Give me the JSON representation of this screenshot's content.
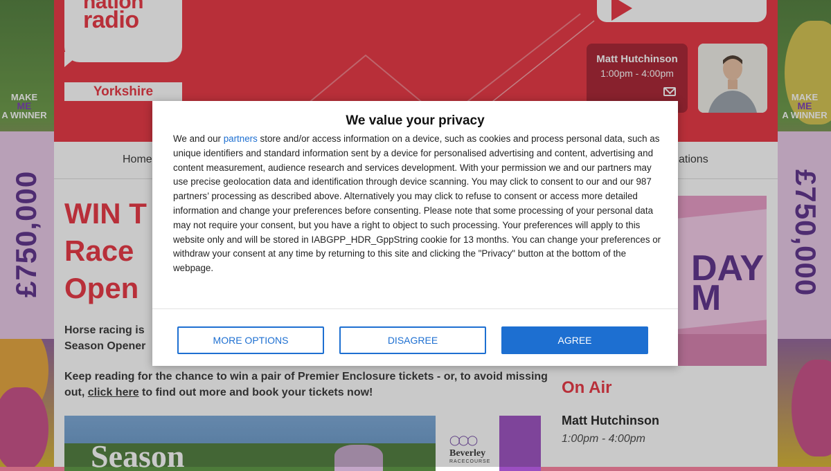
{
  "site": {
    "logo_top": "nation",
    "logo_bottom": "radio",
    "region": "Yorkshire",
    "presenter": {
      "name": "Matt Hutchinson",
      "time": "1:00pm - 4:00pm"
    },
    "nav": {
      "home": "Home",
      "locations_partial": "ations"
    }
  },
  "article": {
    "headline": [
      "WIN T",
      "Race",
      "Open"
    ],
    "intro": [
      "Horse racing is",
      "Season Opener"
    ],
    "para_before_link": "Keep reading for the chance to win a pair of Premier Enclosure tickets - or, to avoid missing out, ",
    "link_text": "click here",
    "para_after_link": " to find out more and book your tickets now!",
    "image_text": "Season",
    "sponsor_name": "Beverley",
    "sponsor_sub": "RACECOURSE"
  },
  "sidebar": {
    "promo_text_1": "DAY",
    "promo_text_2": "M",
    "onair_heading": "On Air",
    "onair_name": "Matt Hutchinson",
    "onair_time": "1:00pm - 4:00pm"
  },
  "ad_skin": {
    "prize_left": "£750,000",
    "prize_right": "£750,000",
    "make_me_a_winner": {
      "make": "MAKE",
      "me": "ME",
      "a_winner": "A WINNER"
    }
  },
  "consent": {
    "title": "We value your privacy",
    "body_before_link": "We and our ",
    "link_text": "partners",
    "body_after_link": " store and/or access information on a device, such as cookies and process personal data, such as unique identifiers and standard information sent by a device for personalised advertising and content, advertising and content measurement, audience research and services development. With your permission we and our partners may use precise geolocation data and identification through device scanning. You may click to consent to our and our 987 partners’ processing as described above. Alternatively you may click to refuse to consent or access more detailed information and change your preferences before consenting. Please note that some processing of your personal data may not require your consent, but you have a right to object to such processing. Your preferences will apply to this website only and will be stored in IABGPP_HDR_GppString cookie for 13 months. You can change your preferences or withdraw your consent at any time by returning to this site and clicking the \"Privacy\" button at the bottom of the webpage.",
    "buttons": {
      "more_options": "MORE OPTIONS",
      "disagree": "DISAGREE",
      "agree": "AGREE"
    }
  },
  "colors": {
    "brand_red": "#e8323f",
    "consent_blue": "#1d6fd1",
    "ad_purple": "#5b2e8a"
  }
}
